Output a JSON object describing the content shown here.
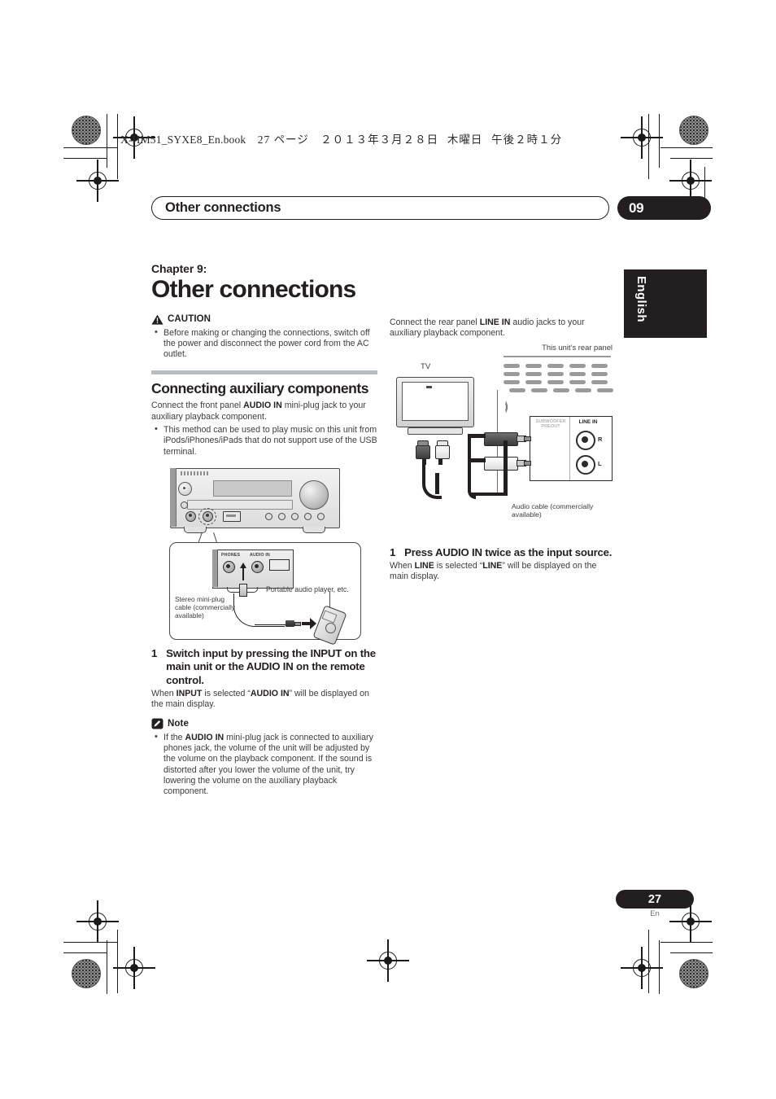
{
  "print_header": {
    "filename": "X-HM51_SYXE8_En.book",
    "page_ref": "27 ページ",
    "date": "２０１３年３月２８日",
    "weekday": "木曜日",
    "time": "午後２時１分"
  },
  "running_head": {
    "title": "Other connections",
    "chapter_badge": "09"
  },
  "side_tab": {
    "language": "English"
  },
  "left_column": {
    "chapter_kicker": "Chapter 9:",
    "chapter_title": "Other connections",
    "caution": {
      "label": "CAUTION",
      "items": [
        "Before making or changing the connections, switch off the power and disconnect the power cord from the AC outlet."
      ]
    },
    "section": {
      "heading": "Connecting auxiliary components",
      "intro_pre": "Connect the front panel ",
      "intro_bold": "AUDIO IN",
      "intro_post": " mini-plug jack to your auxiliary playback component.",
      "bullets": [
        "This method can be used to play music on this unit from iPods/iPhones/iPads that do not support use of the USB terminal."
      ]
    },
    "front_figure": {
      "jack_phones": "PHONES",
      "jack_audio_in": "AUDIO IN",
      "caption_cable": "Stereo mini-plug cable (commercially available)",
      "caption_player": "Portable audio player, etc."
    },
    "step": {
      "number": "1",
      "title": "Switch input by pressing the INPUT on the main unit or the AUDIO IN on the remote control.",
      "sub_a": "When ",
      "sub_b": "INPUT",
      "sub_c": " is selected “",
      "sub_d": "AUDIO IN",
      "sub_e": "” will be displayed on the main display."
    },
    "note": {
      "label": "Note",
      "items_pre": "If the ",
      "items_bold": "AUDIO IN",
      "items_post": " mini-plug jack is connected to auxiliary phones jack, the volume of the unit will be adjusted by the volume on the playback component. If the sound is distorted after you lower the volume of the unit, try lowering the volume on the auxiliary playback component."
    }
  },
  "right_column": {
    "intro_pre": "Connect the rear panel ",
    "intro_bold": "LINE IN",
    "intro_post": " audio jacks to your auxiliary playback component.",
    "rear_figure": {
      "unit_label": "This unit’s rear panel",
      "tv_label": "TV",
      "subwoofer_label": "SUBWOOFER PREOUT",
      "line_in_label": "LINE IN",
      "channel_right": "R",
      "channel_left": "L",
      "caption_cable": "Audio cable (commercially available)"
    },
    "step": {
      "number": "1",
      "title": "Press AUDIO IN twice as the input source.",
      "sub_a": "When ",
      "sub_b": "LINE",
      "sub_c": " is selected “",
      "sub_d": "LINE",
      "sub_e": "” will be displayed on the main display."
    }
  },
  "footer": {
    "page_number": "27",
    "language_code": "En"
  },
  "colors": {
    "ink": "#231f20",
    "body_text": "#3c3c3c",
    "rule_grey": "#b9bcbe"
  }
}
